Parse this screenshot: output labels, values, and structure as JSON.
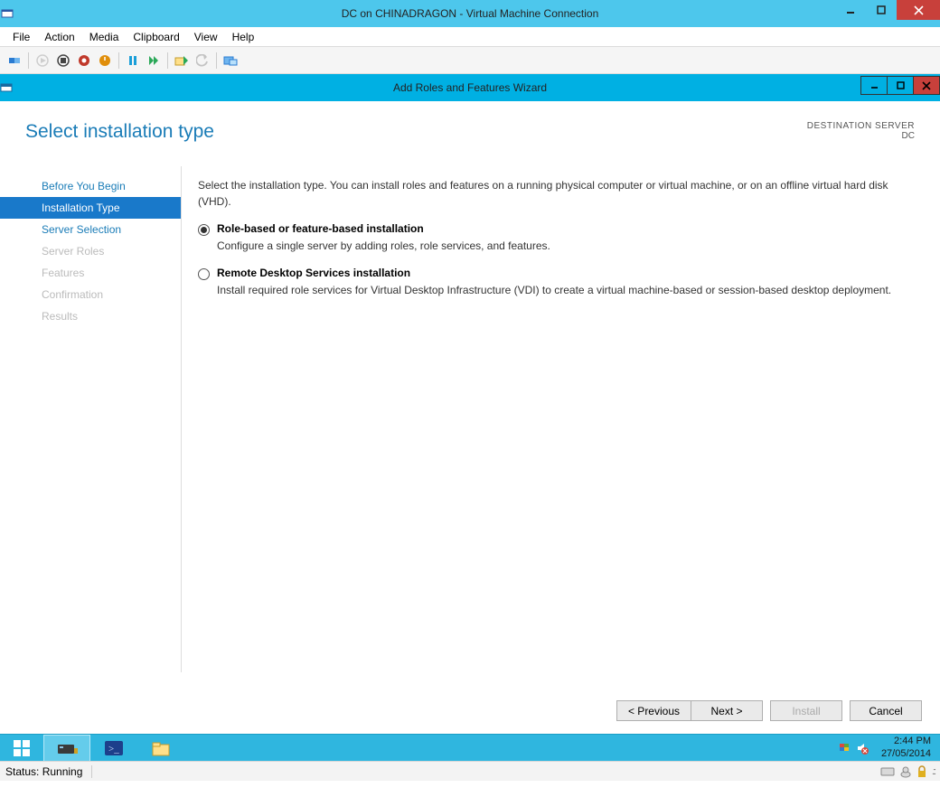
{
  "vm_window": {
    "title": "DC on CHINADRAGON - Virtual Machine Connection"
  },
  "menubar": [
    "File",
    "Action",
    "Media",
    "Clipboard",
    "View",
    "Help"
  ],
  "wizard": {
    "title": "Add Roles and Features Wizard",
    "page_title": "Select installation type",
    "destination_label": "DESTINATION SERVER",
    "destination_value": "DC",
    "nav": [
      {
        "label": "Before You Begin",
        "state": "enabled"
      },
      {
        "label": "Installation Type",
        "state": "active"
      },
      {
        "label": "Server Selection",
        "state": "enabled"
      },
      {
        "label": "Server Roles",
        "state": "disabled"
      },
      {
        "label": "Features",
        "state": "disabled"
      },
      {
        "label": "Confirmation",
        "state": "disabled"
      },
      {
        "label": "Results",
        "state": "disabled"
      }
    ],
    "intro": "Select the installation type. You can install roles and features on a running physical computer or virtual machine, or on an offline virtual hard disk (VHD).",
    "options": [
      {
        "label": "Role-based or feature-based installation",
        "desc": "Configure a single server by adding roles, role services, and features.",
        "checked": true
      },
      {
        "label": "Remote Desktop Services installation",
        "desc": "Install required role services for Virtual Desktop Infrastructure (VDI) to create a virtual machine-based or session-based desktop deployment.",
        "checked": false
      }
    ],
    "buttons": {
      "previous": "< Previous",
      "next": "Next >",
      "install": "Install",
      "cancel": "Cancel"
    }
  },
  "taskbar": {
    "time": "2:44 PM",
    "date": "27/05/2014"
  },
  "status_bar": {
    "status": "Status: Running"
  }
}
